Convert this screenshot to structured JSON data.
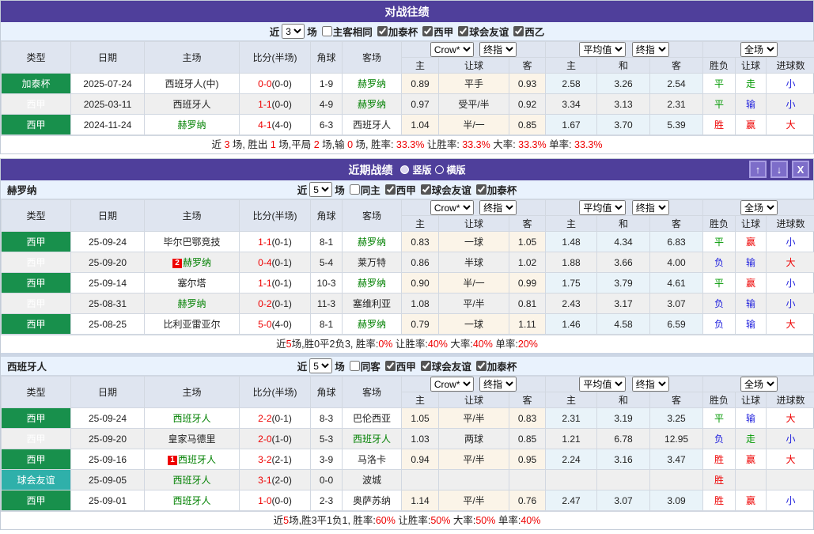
{
  "colors": {
    "header_purple": "#4f3f9b",
    "type_green": "#18904c",
    "type_teal": "#2fb0aa",
    "team_green": "#008000",
    "result_red": "#ee0000",
    "result_blue": "#2222dd",
    "result_green": "#009900"
  },
  "columns": {
    "base": [
      "类型",
      "日期",
      "主场",
      "比分(半场)",
      "角球",
      "客场"
    ],
    "selects": {
      "odds_source": "Crow*",
      "final": "终指",
      "average": "平均值",
      "scope": "全场"
    },
    "sub": [
      "主",
      "让球",
      "客",
      "主",
      "和",
      "客",
      "胜负",
      "让球",
      "进球数"
    ]
  },
  "h2h": {
    "title": "对战往绩",
    "filter": {
      "prefix": "近",
      "games": "3",
      "suffix": "场",
      "options": [
        {
          "label": "主客相同",
          "checked": false
        },
        {
          "label": "加泰杯",
          "checked": true
        },
        {
          "label": "西甲",
          "checked": true
        },
        {
          "label": "球会友谊",
          "checked": true
        },
        {
          "label": "西乙",
          "checked": true
        }
      ]
    },
    "rows": [
      {
        "type": "加泰杯",
        "type_style": "green",
        "date": "2025-07-24",
        "home": "西班牙人(中)",
        "home_green": false,
        "home_badge": "",
        "score": "0-0",
        "half": "(0-0)",
        "corner": "1-9",
        "away": "赫罗纳",
        "away_green": true,
        "odds": [
          "0.89",
          "平手",
          "0.93",
          "2.58",
          "3.26",
          "2.54"
        ],
        "results": [
          [
            "平",
            "green"
          ],
          [
            "走",
            "green"
          ],
          [
            "小",
            "blue"
          ]
        ]
      },
      {
        "type": "西甲",
        "type_style": "green",
        "date": "2025-03-11",
        "home": "西班牙人",
        "home_green": false,
        "home_badge": "",
        "score": "1-1",
        "half": "(0-0)",
        "corner": "4-9",
        "away": "赫罗纳",
        "away_green": true,
        "odds": [
          "0.97",
          "受平/半",
          "0.92",
          "3.34",
          "3.13",
          "2.31"
        ],
        "results": [
          [
            "平",
            "green"
          ],
          [
            "输",
            "blue"
          ],
          [
            "小",
            "blue"
          ]
        ]
      },
      {
        "type": "西甲",
        "type_style": "green",
        "date": "2024-11-24",
        "home": "赫罗纳",
        "home_green": true,
        "home_badge": "",
        "score": "4-1",
        "half": "(4-0)",
        "corner": "6-3",
        "away": "西班牙人",
        "away_green": false,
        "odds": [
          "1.04",
          "半/一",
          "0.85",
          "1.67",
          "3.70",
          "5.39"
        ],
        "results": [
          [
            "胜",
            "red"
          ],
          [
            "赢",
            "red"
          ],
          [
            "大",
            "red"
          ]
        ]
      }
    ],
    "summary": [
      [
        "近 ",
        "k"
      ],
      [
        "3",
        "red"
      ],
      [
        " 场, 胜出 ",
        "k"
      ],
      [
        "1",
        "red"
      ],
      [
        " 场,平局 ",
        "k"
      ],
      [
        "2",
        "red"
      ],
      [
        " 场,输 ",
        "k"
      ],
      [
        "0",
        "red"
      ],
      [
        " 场, 胜率: ",
        "k"
      ],
      [
        "33.3%",
        "red"
      ],
      [
        " 让胜率: ",
        "k"
      ],
      [
        "33.3%",
        "red"
      ],
      [
        " 大率: ",
        "k"
      ],
      [
        "33.3%",
        "red"
      ],
      [
        " 单率: ",
        "k"
      ],
      [
        "33.3%",
        "red"
      ]
    ]
  },
  "recent": {
    "title": "近期战绩",
    "layout_options": [
      {
        "label": "竖版",
        "selected": true
      },
      {
        "label": "横版",
        "selected": false
      }
    ],
    "window_buttons": [
      {
        "name": "up",
        "glyph": "↑"
      },
      {
        "name": "down",
        "glyph": "↓"
      },
      {
        "name": "close",
        "glyph": "X"
      }
    ],
    "sections": [
      {
        "team": "赫罗纳",
        "filter": {
          "prefix": "近",
          "games": "5",
          "suffix": "场",
          "options": [
            {
              "label": "同主",
              "checked": false
            },
            {
              "label": "西甲",
              "checked": true
            },
            {
              "label": "球会友谊",
              "checked": true
            },
            {
              "label": "加泰杯",
              "checked": true
            }
          ]
        },
        "rows": [
          {
            "type": "西甲",
            "type_style": "green",
            "date": "25-09-24",
            "home": "毕尔巴鄂竞技",
            "home_green": false,
            "home_badge": "",
            "score": "1-1",
            "half": "(0-1)",
            "corner": "8-1",
            "away": "赫罗纳",
            "away_green": true,
            "odds": [
              "0.83",
              "一球",
              "1.05",
              "1.48",
              "4.34",
              "6.83"
            ],
            "results": [
              [
                "平",
                "green"
              ],
              [
                "赢",
                "red"
              ],
              [
                "小",
                "blue"
              ]
            ]
          },
          {
            "type": "西甲",
            "type_style": "green",
            "date": "25-09-20",
            "home": "赫罗纳",
            "home_green": true,
            "home_badge": "2",
            "score": "0-4",
            "half": "(0-1)",
            "corner": "5-4",
            "away": "莱万特",
            "away_green": false,
            "odds": [
              "0.86",
              "半球",
              "1.02",
              "1.88",
              "3.66",
              "4.00"
            ],
            "results": [
              [
                "负",
                "blue"
              ],
              [
                "输",
                "blue"
              ],
              [
                "大",
                "red"
              ]
            ]
          },
          {
            "type": "西甲",
            "type_style": "green",
            "date": "25-09-14",
            "home": "塞尔塔",
            "home_green": false,
            "home_badge": "",
            "score": "1-1",
            "half": "(0-1)",
            "corner": "10-3",
            "away": "赫罗纳",
            "away_green": true,
            "odds": [
              "0.90",
              "半/一",
              "0.99",
              "1.75",
              "3.79",
              "4.61"
            ],
            "results": [
              [
                "平",
                "green"
              ],
              [
                "赢",
                "red"
              ],
              [
                "小",
                "blue"
              ]
            ]
          },
          {
            "type": "西甲",
            "type_style": "green",
            "date": "25-08-31",
            "home": "赫罗纳",
            "home_green": true,
            "home_badge": "",
            "score": "0-2",
            "half": "(0-1)",
            "corner": "11-3",
            "away": "塞维利亚",
            "away_green": false,
            "odds": [
              "1.08",
              "平/半",
              "0.81",
              "2.43",
              "3.17",
              "3.07"
            ],
            "results": [
              [
                "负",
                "blue"
              ],
              [
                "输",
                "blue"
              ],
              [
                "小",
                "blue"
              ]
            ]
          },
          {
            "type": "西甲",
            "type_style": "green",
            "date": "25-08-25",
            "home": "比利亚雷亚尔",
            "home_green": false,
            "home_badge": "",
            "score": "5-0",
            "half": "(4-0)",
            "corner": "8-1",
            "away": "赫罗纳",
            "away_green": true,
            "odds": [
              "0.79",
              "一球",
              "1.11",
              "1.46",
              "4.58",
              "6.59"
            ],
            "results": [
              [
                "负",
                "blue"
              ],
              [
                "输",
                "blue"
              ],
              [
                "大",
                "red"
              ]
            ]
          }
        ],
        "summary": [
          [
            "近",
            "k"
          ],
          [
            "5",
            "red"
          ],
          [
            "场,胜0平2负3, 胜率:",
            "k"
          ],
          [
            "0%",
            "red"
          ],
          [
            " 让胜率:",
            "k"
          ],
          [
            "40%",
            "red"
          ],
          [
            " 大率:",
            "k"
          ],
          [
            "40%",
            "red"
          ],
          [
            " 单率:",
            "k"
          ],
          [
            "20%",
            "red"
          ]
        ]
      },
      {
        "team": "西班牙人",
        "filter": {
          "prefix": "近",
          "games": "5",
          "suffix": "场",
          "options": [
            {
              "label": "同客",
              "checked": false
            },
            {
              "label": "西甲",
              "checked": true
            },
            {
              "label": "球会友谊",
              "checked": true
            },
            {
              "label": "加泰杯",
              "checked": true
            }
          ]
        },
        "rows": [
          {
            "type": "西甲",
            "type_style": "green",
            "date": "25-09-24",
            "home": "西班牙人",
            "home_green": true,
            "home_badge": "",
            "score": "2-2",
            "half": "(0-1)",
            "corner": "8-3",
            "away": "巴伦西亚",
            "away_green": false,
            "odds": [
              "1.05",
              "平/半",
              "0.83",
              "2.31",
              "3.19",
              "3.25"
            ],
            "results": [
              [
                "平",
                "green"
              ],
              [
                "输",
                "blue"
              ],
              [
                "大",
                "red"
              ]
            ]
          },
          {
            "type": "西甲",
            "type_style": "green",
            "date": "25-09-20",
            "home": "皇家马德里",
            "home_green": false,
            "home_badge": "",
            "score": "2-0",
            "half": "(1-0)",
            "corner": "5-3",
            "away": "西班牙人",
            "away_green": true,
            "odds": [
              "1.03",
              "两球",
              "0.85",
              "1.21",
              "6.78",
              "12.95"
            ],
            "results": [
              [
                "负",
                "blue"
              ],
              [
                "走",
                "green"
              ],
              [
                "小",
                "blue"
              ]
            ]
          },
          {
            "type": "西甲",
            "type_style": "green",
            "date": "25-09-16",
            "home": "西班牙人",
            "home_green": true,
            "home_badge": "1",
            "score": "3-2",
            "half": "(2-1)",
            "corner": "3-9",
            "away": "马洛卡",
            "away_green": false,
            "odds": [
              "0.94",
              "平/半",
              "0.95",
              "2.24",
              "3.16",
              "3.47"
            ],
            "results": [
              [
                "胜",
                "red"
              ],
              [
                "赢",
                "red"
              ],
              [
                "大",
                "red"
              ]
            ]
          },
          {
            "type": "球会友谊",
            "type_style": "teal",
            "date": "25-09-05",
            "home": "西班牙人",
            "home_green": true,
            "home_badge": "",
            "score": "3-1",
            "half": "(2-0)",
            "corner": "0-0",
            "away": "波城",
            "away_green": false,
            "odds": [
              "",
              "",
              "",
              "",
              "",
              ""
            ],
            "results": [
              [
                "胜",
                "red"
              ],
              [
                "",
                ""
              ],
              [
                "",
                ""
              ]
            ]
          },
          {
            "type": "西甲",
            "type_style": "green",
            "date": "25-09-01",
            "home": "西班牙人",
            "home_green": true,
            "home_badge": "",
            "score": "1-0",
            "half": "(0-0)",
            "corner": "2-3",
            "away": "奥萨苏纳",
            "away_green": false,
            "odds": [
              "1.14",
              "平/半",
              "0.76",
              "2.47",
              "3.07",
              "3.09"
            ],
            "results": [
              [
                "胜",
                "red"
              ],
              [
                "赢",
                "red"
              ],
              [
                "小",
                "blue"
              ]
            ]
          }
        ],
        "summary": [
          [
            "近",
            "k"
          ],
          [
            "5",
            "red"
          ],
          [
            "场,胜3平1负1, 胜率:",
            "k"
          ],
          [
            "60%",
            "red"
          ],
          [
            " 让胜率:",
            "k"
          ],
          [
            "50%",
            "red"
          ],
          [
            " 大率:",
            "k"
          ],
          [
            "50%",
            "red"
          ],
          [
            " 单率:",
            "k"
          ],
          [
            "40%",
            "red"
          ]
        ]
      }
    ]
  }
}
